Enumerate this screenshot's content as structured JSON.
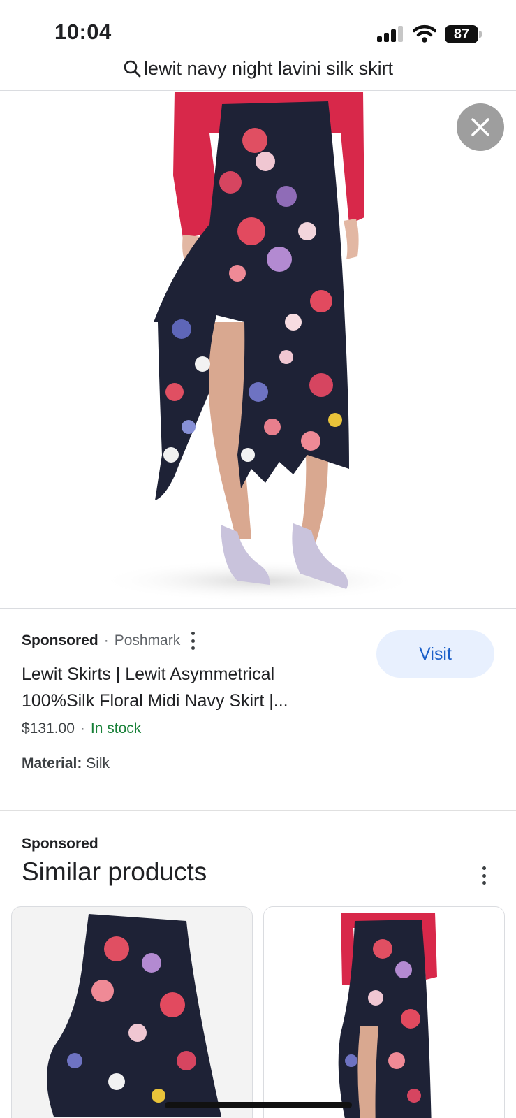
{
  "status_bar": {
    "time": "10:04",
    "battery": "87",
    "icons": [
      "signal-icon",
      "wifi-icon",
      "battery-icon"
    ]
  },
  "search": {
    "icon": "search-icon",
    "query": "lewit navy night lavini silk skirt"
  },
  "hero": {
    "image": "floral-asymmetric-skirt-photo",
    "close_icon": "close-icon"
  },
  "product": {
    "sponsored_label": "Sponsored",
    "separator": "·",
    "merchant": "Poshmark",
    "title": "Lewit Skirts | Lewit Asymmetrical 100%Silk Floral Midi Navy Skirt |...",
    "visit_label": "Visit",
    "price": "$131.00",
    "price_separator": "·",
    "stock": "In stock",
    "material_label": "Material:",
    "material_value": "Silk"
  },
  "similar": {
    "sponsored_label": "Sponsored",
    "title": "Similar products",
    "cards": [
      {
        "image": "floral-skirt-flat-photo"
      },
      {
        "image": "floral-skirt-model-photo"
      }
    ]
  },
  "colors": {
    "accent": "#1a5fc9",
    "visit_bg": "#e8f0fe",
    "in_stock": "#188038",
    "skirt_navy": "#1e2236",
    "sweater_red": "#d8284a"
  }
}
